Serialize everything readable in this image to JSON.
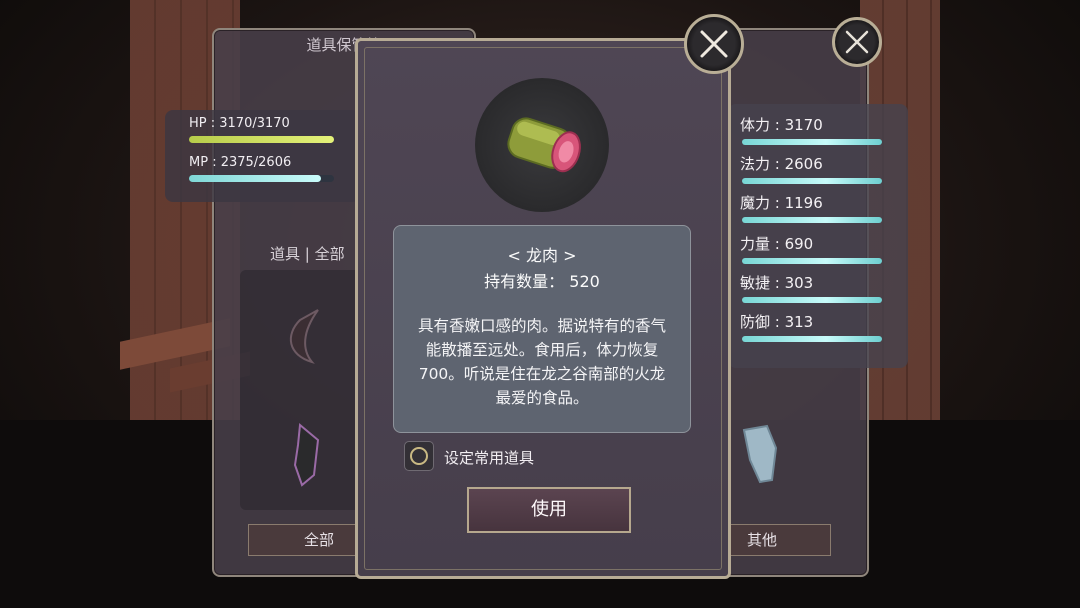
{
  "background_panel": {
    "title": "道具保管箱"
  },
  "player": {
    "hp_label": "HP : 3170/3170",
    "mp_label": "MP : 2375/2606",
    "hp_fraction": 1.0,
    "mp_fraction": 0.91
  },
  "inventory": {
    "tab_label": "道具 | 全部",
    "filter_all": "全部",
    "filter_other": "其他"
  },
  "stats": [
    {
      "label": "体力 : 3170"
    },
    {
      "label": "法力 : 2606"
    },
    {
      "label": "魔力 : 1196"
    },
    {
      "label": "力量 : 690"
    },
    {
      "label": "敏捷 : 303"
    },
    {
      "label": "防御 : 313"
    }
  ],
  "item_detail": {
    "name": "< 龙肉 >",
    "count": "持有数量：  520",
    "description": "具有香嫩口感的肉。据说特有的香气能散播至远处。食用后，体力恢复700。听说是住在龙之谷南部的火龙最爱的食品。",
    "favorite_label": "设定常用道具",
    "favorite_checked": false,
    "use_button": "使用",
    "icon": "meat-icon"
  },
  "colors": {
    "hp_bar": "#d6e86a",
    "mp_bar": "#8fe0df",
    "stat_bar": "#8fe0df",
    "panel_border": "#b7ab95"
  }
}
